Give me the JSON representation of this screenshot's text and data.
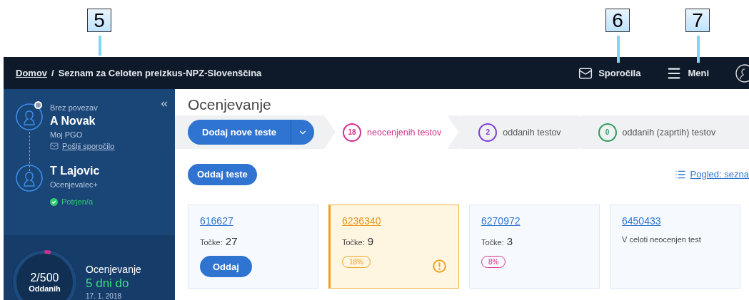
{
  "callouts": [
    {
      "label": "5",
      "kind": "sidebar"
    },
    {
      "label": "6",
      "kind": "messages"
    },
    {
      "label": "7",
      "kind": "menu"
    }
  ],
  "navbar": {
    "breadcrumb_home": "Domov",
    "breadcrumb_separator": "/",
    "breadcrumb_current": "Seznam za Celoten preizkus-NPZ-Slovenščina",
    "messages": "Sporočila",
    "menu": "Meni"
  },
  "sidebar": {
    "people": [
      {
        "status": "Brez povezav",
        "online": false,
        "name": "A Novak",
        "role": "Moj PGO",
        "link": "Pošlji sporočilo"
      },
      {
        "name": "T Lajovic",
        "role": "Ocenjevalec+",
        "confirmed": true,
        "confirmed_label": "Potrjen/a"
      }
    ],
    "progress": {
      "count": "2/500",
      "count_label": "Oddanih",
      "title": "Ocenjevanje",
      "remaining": "5 dni do",
      "date": "17. 1. 2018"
    }
  },
  "main": {
    "title": "Ocenjevanje",
    "add_button": "Dodaj nove teste",
    "steps": [
      {
        "count": "18",
        "label": "neocenjenih testov",
        "color": "#d6308f",
        "selected": true
      },
      {
        "count": "2",
        "label": "oddanih testov",
        "color": "#7b3fd6",
        "selected": false
      },
      {
        "count": "0",
        "label": "oddanih (zaprtih) testov",
        "color": "#2e9e5e",
        "selected": false
      }
    ],
    "submit_button": "Oddaj teste",
    "view_link": "Pogled: sezna",
    "cards": [
      {
        "kind": "button",
        "id": "616627",
        "points_label": "Točke:",
        "points": "27",
        "button": "Oddaj",
        "highlighted": false
      },
      {
        "kind": "badge",
        "id": "6236340",
        "points_label": "Točke:",
        "points": "9",
        "badge": "18%",
        "color": "#f0a020",
        "warning": true,
        "highlighted": true
      },
      {
        "kind": "badge",
        "id": "6270972",
        "points_label": "Točke:",
        "points": "3",
        "badge": "8%",
        "color": "#d6308f",
        "warning": false,
        "highlighted": false
      },
      {
        "kind": "note",
        "id": "6450433",
        "note": "V celoti neocenjen test",
        "highlighted": false
      }
    ]
  }
}
